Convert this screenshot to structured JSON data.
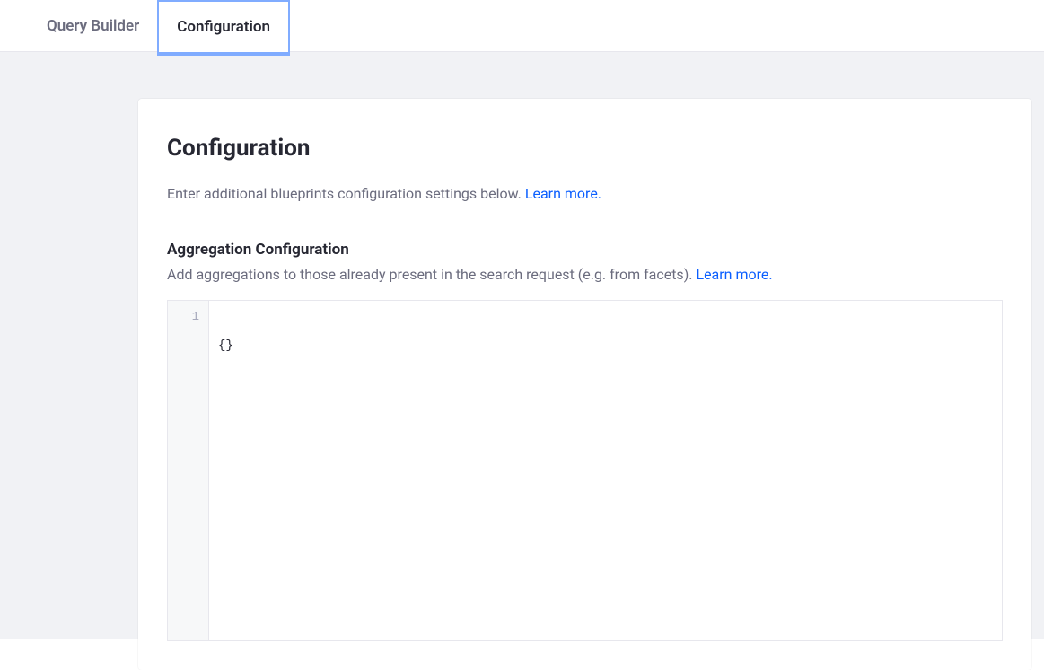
{
  "tabs": {
    "query_builder": "Query Builder",
    "configuration": "Configuration"
  },
  "panel": {
    "title": "Configuration",
    "description_prefix": "Enter additional blueprints configuration settings below. ",
    "learn_more": "Learn more."
  },
  "aggregation": {
    "title": "Aggregation Configuration",
    "description_prefix": "Add aggregations to those already present in the search request (e.g. from facets). ",
    "learn_more": "Learn more."
  },
  "editor": {
    "line_number": "1",
    "content": "{}"
  }
}
